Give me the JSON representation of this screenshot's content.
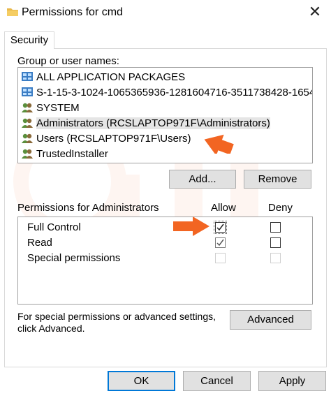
{
  "window": {
    "title": "Permissions for cmd"
  },
  "tabs": [
    {
      "label": "Security"
    }
  ],
  "group_section": {
    "label": "Group or user names:",
    "items": [
      {
        "label": "ALL APPLICATION PACKAGES",
        "icon": "app-packages-icon"
      },
      {
        "label": "S-1-15-3-1024-1065365936-1281604716-3511738428-1654...",
        "icon": "app-packages-icon"
      },
      {
        "label": "SYSTEM",
        "icon": "users-group-icon"
      },
      {
        "label": "Administrators (RCSLAPTOP971F\\Administrators)",
        "icon": "users-group-icon",
        "selected": true
      },
      {
        "label": "Users (RCSLAPTOP971F\\Users)",
        "icon": "users-group-icon"
      },
      {
        "label": "TrustedInstaller",
        "icon": "users-group-icon"
      }
    ],
    "add_label": "Add...",
    "remove_label": "Remove"
  },
  "permissions": {
    "label": "Permissions for Administrators",
    "allow_header": "Allow",
    "deny_header": "Deny",
    "rows": [
      {
        "name": "Full Control",
        "allow": "checked",
        "deny": "unchecked"
      },
      {
        "name": "Read",
        "allow": "checked-inherited",
        "deny": "unchecked"
      },
      {
        "name": "Special permissions",
        "allow": "disabled",
        "deny": "disabled"
      }
    ]
  },
  "advanced": {
    "text_line1": "For special permissions or advanced settings,",
    "text_line2": "click Advanced.",
    "button_label": "Advanced"
  },
  "footer": {
    "ok_label": "OK",
    "cancel_label": "Cancel",
    "apply_label": "Apply"
  },
  "colors": {
    "accent_border": "#0078d7",
    "annotation_arrow": "#f26522",
    "folder": "#e8b84a"
  }
}
